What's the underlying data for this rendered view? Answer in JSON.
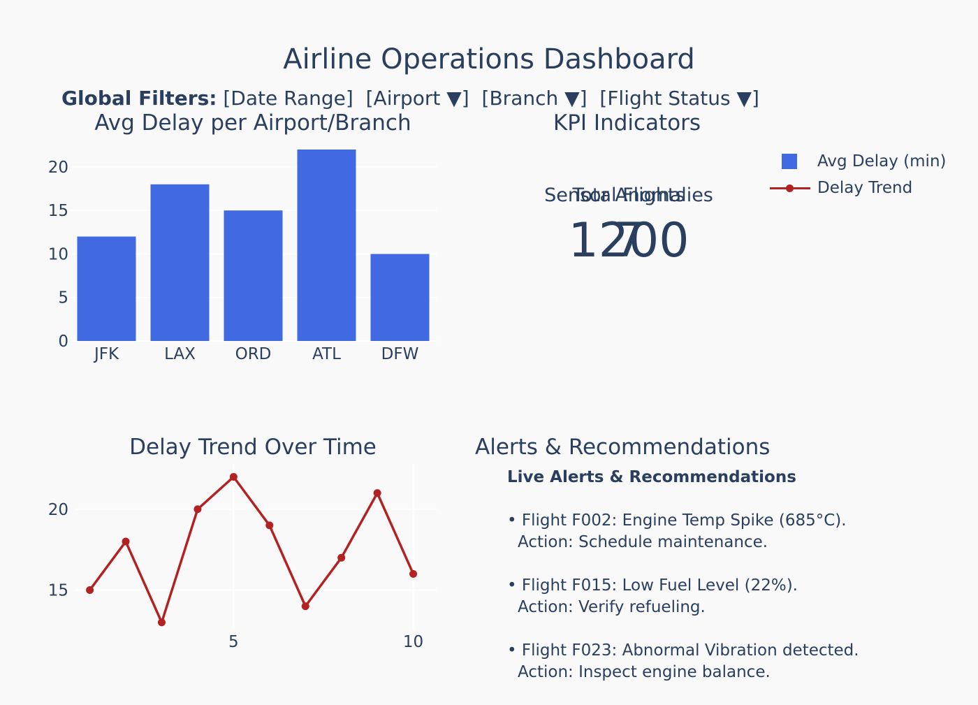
{
  "title": "Airline Operations Dashboard",
  "filters": {
    "label": "Global Filters:",
    "items": [
      "[Date Range]",
      "[Airport ▼]",
      "[Branch ▼]",
      "[Flight Status ▼]"
    ]
  },
  "panels": {
    "bar_title": "Avg Delay per Airport/Branch",
    "kpi_title": "KPI Indicators",
    "line_title": "Delay Trend Over Time",
    "alerts_title": "Alerts & Recommendations"
  },
  "kpis": [
    {
      "label": "Total Flights",
      "value": "1200"
    },
    {
      "label": "Sensor Anomalies",
      "value": "7"
    }
  ],
  "legend": [
    {
      "name": "Avg Delay (min)",
      "color": "#4169e1",
      "kind": "bar"
    },
    {
      "name": "Delay Trend",
      "color": "#b22222",
      "kind": "line"
    }
  ],
  "alerts": {
    "heading": "Live Alerts & Recommendations",
    "items": [
      {
        "text": "• Flight F002: Engine Temp Spike (685°C).",
        "action": "Action: Schedule maintenance."
      },
      {
        "text": "• Flight F015: Low Fuel Level (22%).",
        "action": "Action: Verify refueling."
      },
      {
        "text": "• Flight F023: Abnormal Vibration detected.",
        "action": "Action: Inspect engine balance."
      }
    ]
  },
  "chart_data": [
    {
      "type": "bar",
      "title": "Avg Delay per Airport/Branch",
      "categories": [
        "JFK",
        "LAX",
        "ORD",
        "ATL",
        "DFW"
      ],
      "series": [
        {
          "name": "Avg Delay (min)",
          "values": [
            12,
            18,
            15,
            22,
            10
          ],
          "color": "#4169e1"
        }
      ],
      "ylim": [
        0,
        22
      ],
      "yticks": [
        0,
        5,
        10,
        15,
        20
      ],
      "grid": true
    },
    {
      "type": "line",
      "title": "Delay Trend Over Time",
      "x": [
        1,
        2,
        3,
        4,
        5,
        6,
        7,
        8,
        9,
        10
      ],
      "series": [
        {
          "name": "Delay Trend",
          "values": [
            15,
            18,
            13,
            20,
            22,
            19,
            14,
            17,
            21,
            16
          ],
          "color": "#b22222"
        }
      ],
      "xlim": [
        0.6,
        10.65
      ],
      "ylim": [
        12.6,
        22.8
      ],
      "xticks": [
        5,
        10
      ],
      "yticks": [
        15,
        20
      ],
      "grid": true
    }
  ]
}
